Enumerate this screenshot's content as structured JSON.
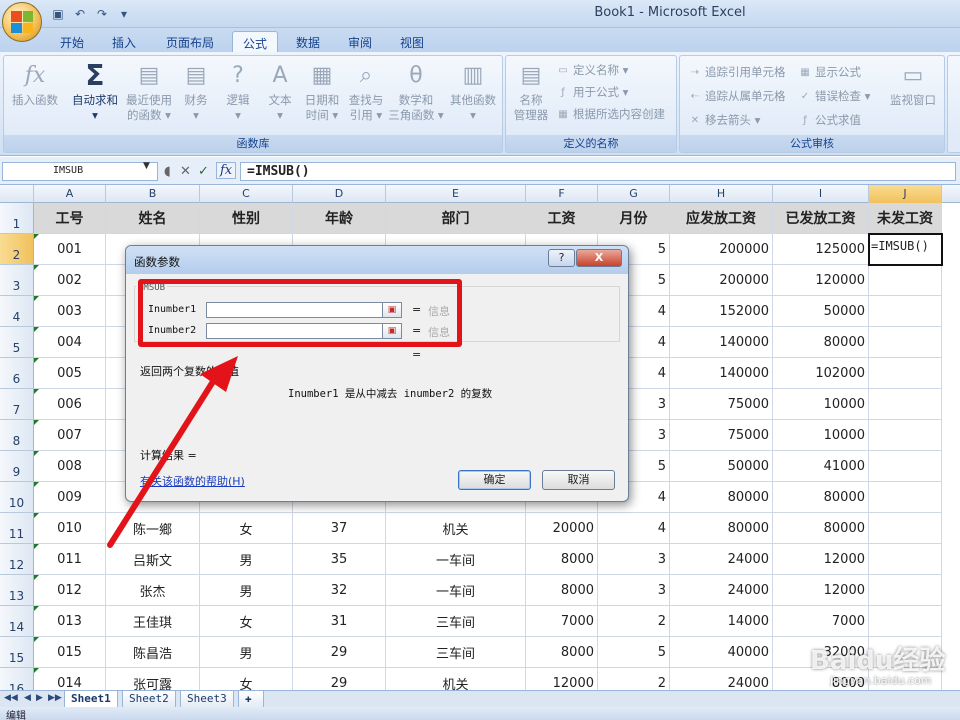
{
  "window": {
    "title": "Book1 - Microsoft Excel"
  },
  "tabs": [
    {
      "label": "开始"
    },
    {
      "label": "插入"
    },
    {
      "label": "页面布局"
    },
    {
      "label": "公式"
    },
    {
      "label": "数据"
    },
    {
      "label": "审阅"
    },
    {
      "label": "视图"
    }
  ],
  "ribbon": {
    "function_library": {
      "label": "函数库",
      "insert_function": {
        "icon": "fx",
        "line1": "插入函数"
      },
      "autosum": {
        "icon": "Σ",
        "line1": "自动求和",
        "line2": "▾"
      },
      "recent": {
        "line1": "最近使用",
        "line2": "的函数 ▾"
      },
      "financial": {
        "line1": "财务",
        "line2": "▾"
      },
      "logical": {
        "line1": "逻辑",
        "line2": "▾"
      },
      "text": {
        "line1": "文本",
        "line2": "▾"
      },
      "datetime": {
        "line1": "日期和",
        "line2": "时间 ▾"
      },
      "lookup": {
        "line1": "查找与",
        "line2": "引用 ▾"
      },
      "math": {
        "line1": "数学和",
        "line2": "三角函数 ▾"
      },
      "other": {
        "line1": "其他函数",
        "line2": "▾"
      }
    },
    "defined_names": {
      "label": "定义的名称",
      "name_manager": {
        "line1": "名称",
        "line2": "管理器"
      },
      "define_name": "定义名称 ▾",
      "use_in_formula": "用于公式 ▾",
      "create_from_selection": "根据所选内容创建"
    },
    "formula_auditing": {
      "label": "公式审核",
      "trace_precedents": "追踪引用单元格",
      "trace_dependents": "追踪从属单元格",
      "remove_arrows": "移去箭头 ▾",
      "show_formulas": "显示公式",
      "error_checking": "错误检查 ▾",
      "evaluate_formula": "公式求值",
      "watch_window": "监视窗口"
    }
  },
  "formula_bar": {
    "name_box": "IMSUB",
    "formula": "=IMSUB()"
  },
  "columns": [
    "A",
    "B",
    "C",
    "D",
    "E",
    "F",
    "G",
    "H",
    "I",
    "J"
  ],
  "rows": [
    "1",
    "2",
    "3",
    "4",
    "5",
    "6",
    "7",
    "8",
    "9",
    "10",
    "11",
    "12",
    "13",
    "14",
    "15",
    "16"
  ],
  "table": {
    "headers": [
      "工号",
      "姓名",
      "性别",
      "年龄",
      "部门",
      "工资",
      "月份",
      "应发放工资",
      "已发放工资",
      "未发工资"
    ],
    "rows": [
      [
        "001",
        "",
        "",
        "",
        "",
        "",
        "5",
        "200000",
        "125000"
      ],
      [
        "002",
        "",
        "",
        "",
        "",
        "",
        "5",
        "200000",
        "120000"
      ],
      [
        "003",
        "",
        "",
        "",
        "",
        "",
        "4",
        "152000",
        "50000"
      ],
      [
        "004",
        "",
        "",
        "",
        "",
        "",
        "4",
        "140000",
        "80000"
      ],
      [
        "005",
        "",
        "",
        "",
        "",
        "",
        "4",
        "140000",
        "102000"
      ],
      [
        "006",
        "",
        "",
        "",
        "",
        "",
        "3",
        "75000",
        "10000"
      ],
      [
        "007",
        "",
        "",
        "",
        "",
        "",
        "3",
        "75000",
        "10000"
      ],
      [
        "008",
        "",
        "",
        "",
        "",
        "",
        "5",
        "50000",
        "41000"
      ],
      [
        "009",
        "",
        "",
        "",
        "",
        "",
        "4",
        "80000",
        "80000"
      ],
      [
        "010",
        "陈一鄉",
        "女",
        "37",
        "机关",
        "20000",
        "4",
        "80000",
        "80000"
      ],
      [
        "011",
        "吕斯文",
        "男",
        "35",
        "一车间",
        "8000",
        "3",
        "24000",
        "12000"
      ],
      [
        "012",
        "张杰",
        "男",
        "32",
        "一车间",
        "8000",
        "3",
        "24000",
        "12000"
      ],
      [
        "013",
        "王佳琪",
        "女",
        "31",
        "三车间",
        "7000",
        "2",
        "14000",
        "7000"
      ],
      [
        "015",
        "陈昌浩",
        "男",
        "29",
        "三车间",
        "8000",
        "5",
        "40000",
        "32000"
      ],
      [
        "014",
        "张可露",
        "女",
        "29",
        "机关",
        "12000",
        "2",
        "24000",
        "8000"
      ]
    ],
    "active_cell": "=IMSUB()"
  },
  "sheets": [
    "Sheet1",
    "Sheet2",
    "Sheet3"
  ],
  "status": "编辑",
  "dialog": {
    "title": "函数参数",
    "help_button": "?",
    "close_button": "X",
    "function_name": "IMSUB",
    "arguments": [
      {
        "label": "Inumber1",
        "value": "",
        "result": "信息"
      },
      {
        "label": "Inumber2",
        "value": "",
        "result": "信息"
      }
    ],
    "equals": "=",
    "description": "返回两个复数的差值",
    "argument_help": "Inumber1  是从中减去 inumber2 的复数",
    "calc_result": "计算结果 =",
    "help_link": "有关该函数的帮助(H)",
    "ok": "确定",
    "cancel": "取消"
  },
  "watermark": {
    "logo": "Baidu经验",
    "url": "jingyan.baidu.com"
  },
  "colors": {
    "annotation": "#e3131a",
    "ribbon_text": "#15428b",
    "header_fill": "#d9d9d9"
  }
}
